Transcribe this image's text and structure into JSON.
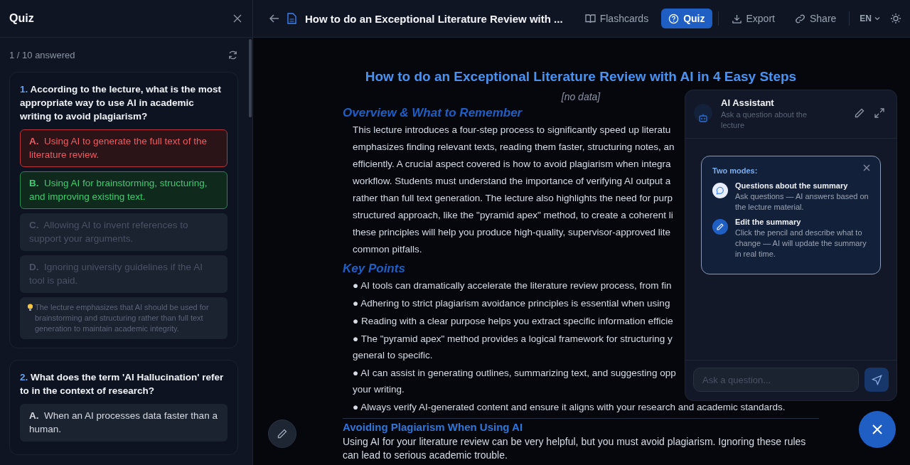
{
  "sidebar": {
    "title": "Quiz",
    "progress": "1 / 10 answered",
    "questions": [
      {
        "number": "1.",
        "text": "According to the lecture, what is the most appropriate way to use AI in academic writing to avoid plagiarism?",
        "options": [
          {
            "letter": "A.",
            "text": "Using AI to generate the full text of the literature review.",
            "selected": true,
            "correct": false,
            "disabled": false
          },
          {
            "letter": "B.",
            "text": "Using AI for brainstorming, structuring, and improving existing text.",
            "selected": false,
            "correct": true,
            "disabled": false
          },
          {
            "letter": "C.",
            "text": "Allowing AI to invent references to support your arguments.",
            "selected": false,
            "correct": false,
            "disabled": true
          },
          {
            "letter": "D.",
            "text": "Ignoring university guidelines if the AI tool is paid.",
            "selected": false,
            "correct": false,
            "disabled": true
          }
        ],
        "hint": "The lecture emphasizes that AI should be used for brainstorming and structuring rather than full text generation to maintain academic integrity."
      },
      {
        "number": "2.",
        "text": "What does the term 'AI Hallucination' refer to in the context of research?",
        "options": [
          {
            "letter": "A.",
            "text": "When an AI processes data faster than a human.",
            "selected": false,
            "correct": false,
            "disabled": false
          }
        ]
      }
    ]
  },
  "toolbar": {
    "title": "How to do an Exceptional Literature Review with ...",
    "tabs": [
      {
        "label": "Flashcards",
        "selected": false
      },
      {
        "label": "Quiz",
        "selected": true
      }
    ],
    "actions": [
      {
        "label": "Export"
      },
      {
        "label": "Share"
      }
    ],
    "language": "EN"
  },
  "document": {
    "title": "How to do an Exceptional Literature Review with AI in 4 Easy Steps",
    "subtitle": "[no data]",
    "overview_heading": "Overview & What to Remember",
    "overview_lines": [
      "This lecture introduces a four-step process to significantly speed up literatu",
      "emphasizes finding relevant texts, reading them faster, structuring notes, an",
      "efficiently. A crucial aspect covered is how to avoid plagiarism when integra",
      "workflow. Students must understand the importance of verifying AI output a",
      "rather than full text generation. The lecture also highlights the need for purp",
      "structured approach, like the \"pyramid apex\" method, to create a coherent li",
      "these principles will help you produce high-quality, supervisor-approved lite",
      "common pitfalls."
    ],
    "key_points_heading": "Key Points",
    "key_points": [
      {
        "lines": [
          "● AI tools can dramatically accelerate the literature review process, from fin"
        ]
      },
      {
        "lines": [
          "● Adhering to strict plagiarism avoidance principles is essential when using"
        ]
      },
      {
        "lines": [
          "● Reading with a clear purpose helps you extract specific information efficie"
        ]
      },
      {
        "lines": [
          "● The \"pyramid apex\" method provides a logical framework for structuring y",
          "general to specific."
        ]
      },
      {
        "lines": [
          "● AI can assist in generating outlines, summarizing text, and suggesting opp",
          "your writing."
        ]
      },
      {
        "lines": [
          "● Always verify AI-generated content and ensure it aligns with your research and academic standards."
        ]
      }
    ],
    "section_heading": "Avoiding Plagiarism When Using AI",
    "section_text": "Using AI for your literature review can be very helpful, but you must avoid plagiarism. Ignoring these rules can lead to serious academic trouble."
  },
  "assistant": {
    "title": "AI Assistant",
    "subtitle": "Ask a question about the lecture",
    "tip": {
      "heading": "Two modes:",
      "modes": [
        {
          "kind": "chat",
          "title": "Questions about the summary",
          "text": "Ask questions — AI answers based on the lecture material."
        },
        {
          "kind": "edit",
          "title": "Edit the summary",
          "text": "Click the pencil and describe what to change — AI will update the summary in real time."
        }
      ]
    },
    "input": {
      "placeholder": "Ask a question..."
    }
  }
}
